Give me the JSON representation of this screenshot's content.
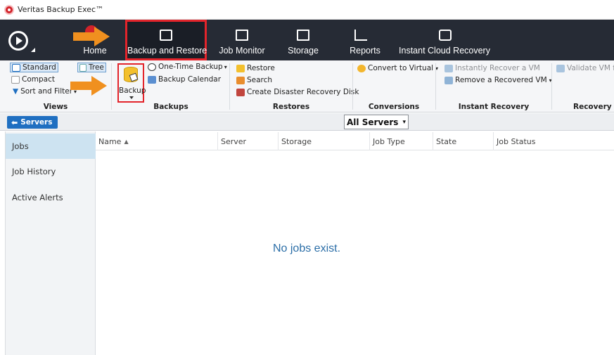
{
  "window": {
    "title": "Veritas Backup Exec™"
  },
  "nav": {
    "home_label": "Home",
    "tabs": [
      {
        "label": "Backup and Restore",
        "icon": "backup-restore-icon",
        "selected": true
      },
      {
        "label": "Job Monitor",
        "icon": "job-monitor-icon"
      },
      {
        "label": "Storage",
        "icon": "storage-icon"
      },
      {
        "label": "Reports",
        "icon": "reports-icon"
      },
      {
        "label": "Instant Cloud Recovery",
        "icon": "cloud-recovery-icon"
      }
    ]
  },
  "ribbon": {
    "views": {
      "standard": "Standard",
      "tree": "Tree",
      "compact": "Compact",
      "sort_filter": "Sort and Filter",
      "label": "Views"
    },
    "backups": {
      "backup": "Backup",
      "one_time": "One-Time Backup",
      "calendar": "Backup Calendar",
      "label": "Backups"
    },
    "restores": {
      "restore": "Restore",
      "search": "Search",
      "disaster": "Create Disaster Recovery Disk",
      "label": "Restores"
    },
    "conversions": {
      "convert": "Convert to Virtual",
      "label": "Conversions"
    },
    "instant_recovery": {
      "instantly": "Instantly Recover a VM",
      "remove": "Remove a Recovered VM",
      "label": "Instant Recovery"
    },
    "recovery": {
      "validate": "Validate VM fo",
      "label": "Recovery R"
    }
  },
  "serverbar": {
    "back_label": "Servers",
    "filter": "All Servers"
  },
  "sidebar": {
    "items": [
      "Jobs",
      "Job History",
      "Active Alerts"
    ]
  },
  "table": {
    "columns": [
      "Name",
      "Server",
      "Storage",
      "Job Type",
      "State",
      "Job Status"
    ],
    "sort_indicator": "▲",
    "empty_message": "No jobs exist."
  },
  "colors": {
    "nav_bg": "#262b35",
    "highlight_red": "#e3242b",
    "arrow_orange": "#f0901f",
    "accent_blue": "#1f6fc1",
    "sidebar_active": "#cde3f1"
  }
}
